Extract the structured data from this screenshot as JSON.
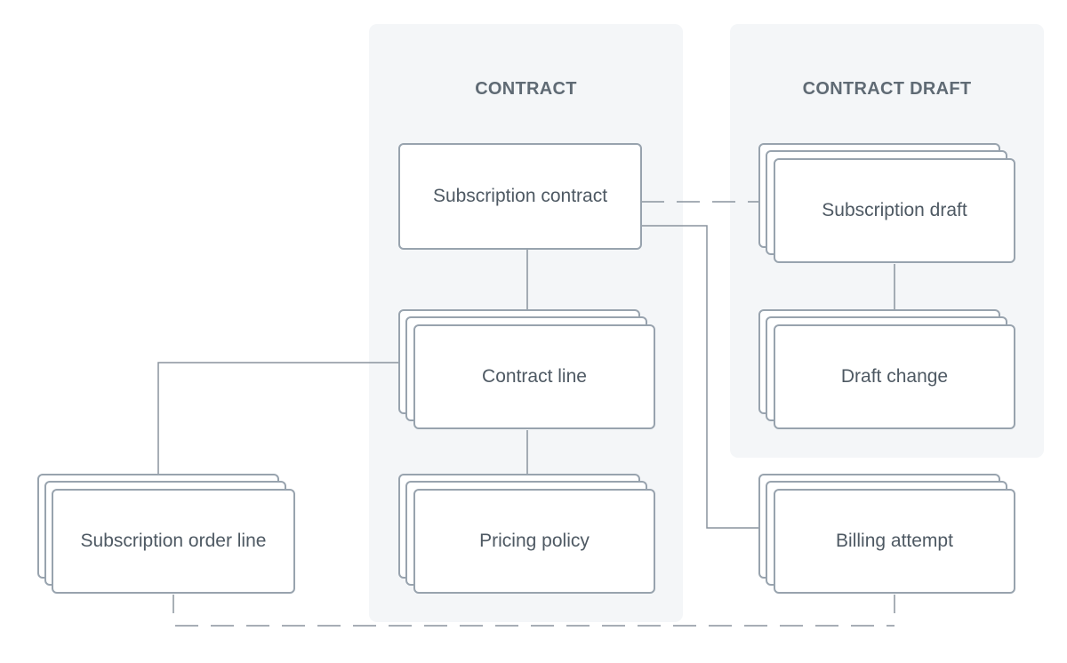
{
  "panels": {
    "contract": {
      "title": "CONTRACT"
    },
    "contract_draft": {
      "title": "CONTRACT DRAFT"
    }
  },
  "nodes": {
    "subscription_contract": "Subscription contract",
    "contract_line": "Contract line",
    "pricing_policy": "Pricing policy",
    "subscription_draft": "Subscription draft",
    "draft_change": "Draft change",
    "billing_attempt": "Billing attempt",
    "subscription_order_line": "Subscription order line"
  },
  "colors": {
    "panel_bg": "#f4f6f8",
    "border": "#98a3ae",
    "text": "#4e5963",
    "connector": "#8a949d"
  }
}
